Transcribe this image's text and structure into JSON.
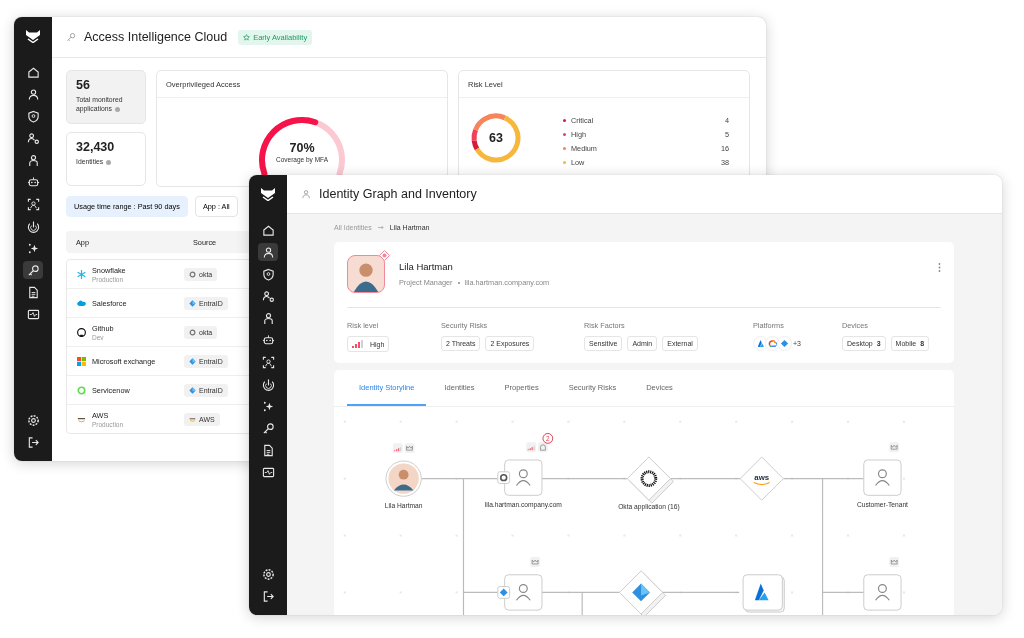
{
  "back_window": {
    "title": "Access Intelligence Cloud",
    "badge": "Early Availability",
    "sidebar": [
      {
        "kind": "home",
        "selected": false
      },
      {
        "kind": "person",
        "selected": false
      },
      {
        "kind": "shield",
        "selected": false
      },
      {
        "kind": "people",
        "selected": false
      },
      {
        "kind": "badge",
        "selected": false
      },
      {
        "kind": "robot",
        "selected": false
      },
      {
        "kind": "scan",
        "selected": false
      },
      {
        "kind": "radar",
        "selected": false
      },
      {
        "kind": "sparkle",
        "selected": false
      },
      {
        "kind": "key",
        "selected": true
      },
      {
        "kind": "document",
        "selected": false
      },
      {
        "kind": "monitor",
        "selected": false
      }
    ],
    "sidebar_bottom": [
      {
        "kind": "gear"
      },
      {
        "kind": "logout"
      }
    ],
    "stats": [
      {
        "value": "56",
        "label": "Total monitored applications",
        "selected": true
      },
      {
        "value": "32,430",
        "label": "Identities",
        "selected": false
      }
    ],
    "overprivileged": {
      "title": "Overprivileged Access",
      "value": "70%",
      "caption": "Coverage by MFA",
      "level": 0.7
    },
    "risk": {
      "title": "Risk Level",
      "score": "63",
      "items": [
        {
          "label": "Critical",
          "count": "4",
          "color": "#d81b3c"
        },
        {
          "label": "High",
          "count": "5",
          "color": "#f0405a"
        },
        {
          "label": "Medium",
          "count": "16",
          "color": "#f7845a"
        },
        {
          "label": "Low",
          "count": "38",
          "color": "#f6b73c"
        }
      ]
    },
    "filters": [
      {
        "label": "Usage time range : Past 90 days",
        "selected": true
      },
      {
        "label": "App : All",
        "selected": false
      }
    ],
    "table": {
      "columns": [
        "App",
        "Source"
      ],
      "rows": [
        {
          "kind": "snowflake",
          "name": "Snowflake",
          "detail": "Production",
          "source": {
            "label": "okta",
            "kind": "okta"
          }
        },
        {
          "kind": "cloud",
          "name": "Salesforce",
          "source": {
            "label": "EntraID",
            "kind": "entra"
          }
        },
        {
          "kind": "octocat",
          "name": "Github",
          "detail": "Dev",
          "source": {
            "label": "okta",
            "kind": "okta"
          }
        },
        {
          "kind": "squares",
          "name": "Microsoft exchange",
          "source": {
            "label": "EntraID",
            "kind": "entra"
          }
        },
        {
          "kind": "ring",
          "name": "Servicenow",
          "source": {
            "label": "EntraID",
            "kind": "entra"
          }
        },
        {
          "kind": "aws",
          "name": "AWS",
          "detail": "Production",
          "source": {
            "label": "AWS",
            "kind": "aws"
          }
        }
      ]
    }
  },
  "front_window": {
    "title": "Identity Graph and Inventory",
    "sidebar": [
      {
        "kind": "home",
        "selected": false
      },
      {
        "kind": "person",
        "selected": true
      },
      {
        "kind": "shield",
        "selected": false
      },
      {
        "kind": "people",
        "selected": false
      },
      {
        "kind": "badge",
        "selected": false
      },
      {
        "kind": "robot",
        "selected": false
      },
      {
        "kind": "scan",
        "selected": false
      },
      {
        "kind": "radar",
        "selected": false
      },
      {
        "kind": "sparkle",
        "selected": false
      },
      {
        "kind": "key",
        "selected": false
      },
      {
        "kind": "document",
        "selected": false
      },
      {
        "kind": "monitor",
        "selected": false
      }
    ],
    "sidebar_bottom": [
      {
        "kind": "gear"
      },
      {
        "kind": "logout"
      }
    ],
    "breadcrumb": [
      "All Identities",
      "Lila Hartman"
    ],
    "profile": {
      "name": "Lila Hartman",
      "role": "Project Manager",
      "email": "lila.hartman.company.com",
      "fields": [
        {
          "label": "Risk level",
          "kind": "risk",
          "chips": [
            "High"
          ]
        },
        {
          "label": "Security Risks",
          "kind": "chips",
          "chips": [
            "2 Threats",
            "2 Exposures"
          ]
        },
        {
          "label": "Risk Factors",
          "kind": "chips",
          "chips": [
            "Sensitive",
            "Admin",
            "External"
          ]
        },
        {
          "label": "Platforms",
          "kind": "platforms",
          "icons": [
            {
              "kind": "azure"
            },
            {
              "kind": "gcp"
            },
            {
              "kind": "entra"
            }
          ],
          "more": "+3"
        },
        {
          "label": "Devices",
          "kind": "chips",
          "chips": [
            "Desktop **3**",
            "Mobile **8**"
          ]
        }
      ]
    },
    "tabs": [
      {
        "label": "Identity Storyline",
        "selected": true
      },
      {
        "label": "Identities",
        "selected": false
      },
      {
        "label": "Properties",
        "selected": false
      },
      {
        "label": "Security Risks",
        "selected": false
      },
      {
        "label": "Devices",
        "selected": false
      }
    ],
    "graph": {
      "nodes": [
        {
          "kind": "person",
          "label": "Lila Hartman",
          "badges": [
            {
              "kind": "risk"
            },
            {
              "kind": "crown"
            }
          ]
        },
        {
          "kind": "identity",
          "label": "lila.hartman.company.com",
          "source": {
            "kind": "okta"
          },
          "badges": [
            {
              "kind": "risk"
            },
            {
              "kind": "alert"
            }
          ],
          "alert_count": "2"
        },
        {
          "kind": "okta",
          "label": "Okta application (16)"
        },
        {
          "kind": "aws",
          "logo": "aws"
        },
        {
          "kind": "identity",
          "label": "Customer-Tenant",
          "badges": [
            {
              "kind": "crown"
            }
          ]
        },
        {
          "kind": "identity",
          "source": {
            "kind": "entra"
          },
          "badges": [
            {
              "kind": "crown"
            }
          ]
        },
        {
          "kind": "entra"
        },
        {
          "kind": "azure"
        },
        {
          "kind": "identity",
          "badges": [
            {
              "kind": "crown"
            }
          ]
        }
      ]
    }
  }
}
